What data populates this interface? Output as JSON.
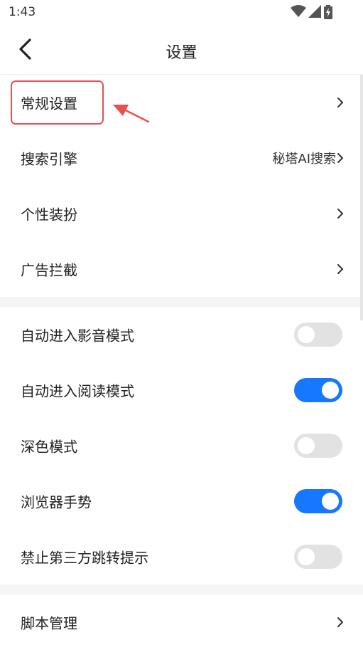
{
  "status_bar": {
    "time": "1:43",
    "icons": [
      "wifi-icon",
      "signal-icon",
      "battery-charging-icon"
    ]
  },
  "header": {
    "title": "设置",
    "back_icon": "chevron-left-icon"
  },
  "settings_group_1": [
    {
      "label": "常规设置",
      "value": "",
      "highlighted": true
    },
    {
      "label": "搜索引擎",
      "value": "秘塔AI搜索"
    },
    {
      "label": "个性装扮",
      "value": ""
    },
    {
      "label": "广告拦截",
      "value": ""
    }
  ],
  "settings_group_2": [
    {
      "label": "自动进入影音模式",
      "toggle": false
    },
    {
      "label": "自动进入阅读模式",
      "toggle": true
    },
    {
      "label": "深色模式",
      "toggle": false
    },
    {
      "label": "浏览器手势",
      "toggle": true
    },
    {
      "label": "禁止第三方跳转提示",
      "toggle": false
    }
  ],
  "settings_group_3": [
    {
      "label": "脚本管理",
      "value": ""
    }
  ],
  "colors": {
    "toggle_on": "#1677ff",
    "toggle_off": "#e2e2e2",
    "annotation_red": "#ea4f4f",
    "section_gap": "#f5f5f5"
  }
}
